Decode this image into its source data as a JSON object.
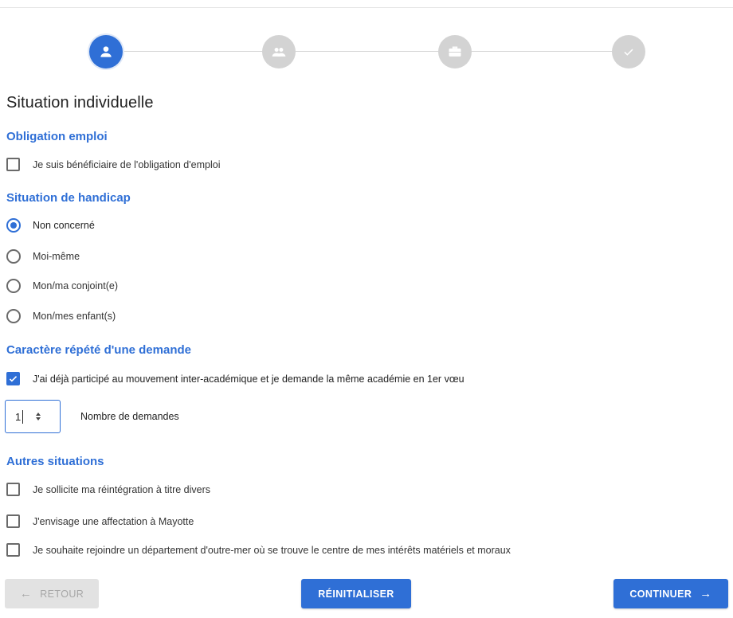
{
  "stepper": {
    "steps": [
      {
        "icon": "person-icon",
        "state": "active"
      },
      {
        "icon": "group-icon",
        "state": "inactive"
      },
      {
        "icon": "briefcase-icon",
        "state": "inactive"
      },
      {
        "icon": "check-icon",
        "state": "inactive"
      }
    ]
  },
  "title": "Situation individuelle",
  "obligation": {
    "heading": "Obligation emploi",
    "checkbox_label": "Je suis bénéficiaire de l'obligation d'emploi",
    "checked": false
  },
  "handicap": {
    "heading": "Situation de handicap",
    "options": [
      {
        "label": "Non concerné",
        "selected": true
      },
      {
        "label": "Moi-même",
        "selected": false
      },
      {
        "label": "Mon/ma conjoint(e)",
        "selected": false
      },
      {
        "label": "Mon/mes enfant(s)",
        "selected": false
      }
    ]
  },
  "repeat": {
    "heading": "Caractère répété d'une demande",
    "checkbox_label": "J'ai déjà participé au mouvement inter-académique et je demande la même académie en 1er vœu",
    "checked": true,
    "count_value": "1",
    "count_label": "Nombre de demandes"
  },
  "other": {
    "heading": "Autres situations",
    "items": [
      {
        "label": "Je sollicite ma réintégration à titre divers",
        "checked": false
      },
      {
        "label": "J'envisage une affectation à Mayotte",
        "checked": false
      },
      {
        "label": "Je souhaite rejoindre un département d'outre-mer où se trouve le centre de mes intérêts matériels et moraux",
        "checked": false
      }
    ]
  },
  "buttons": {
    "back": "RETOUR",
    "reset": "RÉINITIALISER",
    "continue": "CONTINUER"
  },
  "colors": {
    "accent": "#2f6fd6",
    "inactive": "#d3d3d3"
  }
}
